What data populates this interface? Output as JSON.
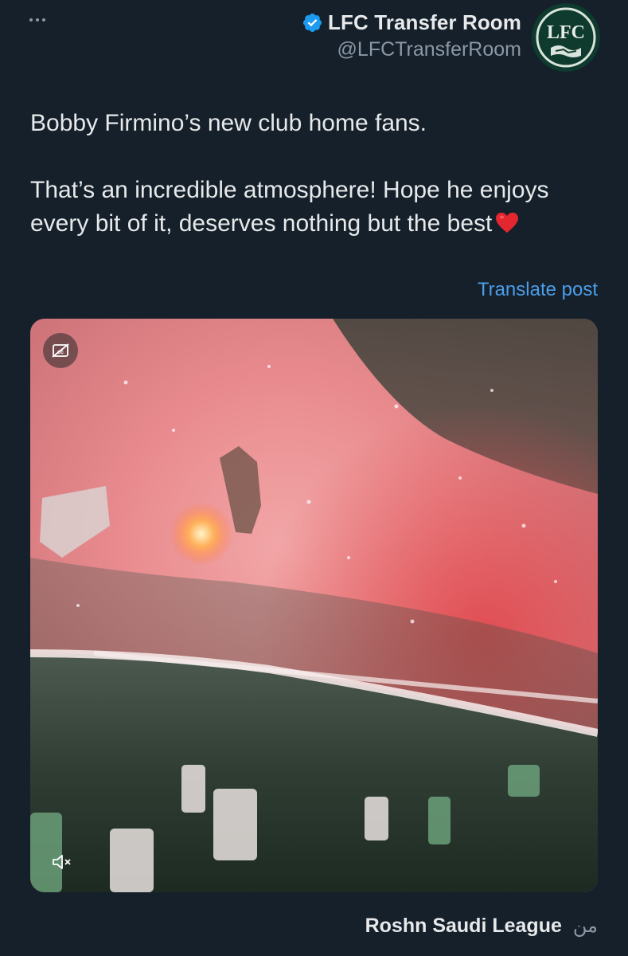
{
  "header": {
    "more_icon": "more-horizontal-icon",
    "display_name": "LFC Transfer Room",
    "handle": "@LFCTransferRoom",
    "verified_icon": "verified-badge-icon",
    "avatar_logo_text": "LFC"
  },
  "tweet": {
    "line1": "Bobby Firmino’s new club home fans.",
    "line2": "That’s an incredible atmosphere! Hope he enjoys every bit of it, deserves nothing but the best",
    "emoji_icon": "red-heart-icon"
  },
  "translate_label": "Translate post",
  "media": {
    "captions_icon": "closed-captions-off-icon",
    "mute_icon": "volume-muted-icon"
  },
  "place": {
    "prefix": "من",
    "name": "Roshn Saudi League"
  },
  "colors": {
    "background": "#15202b",
    "text": "#e7e9ea",
    "muted": "#8b98a5",
    "link": "#4c9ee8",
    "verified": "#1d9bf0",
    "avatar_green": "#0f3b2e"
  }
}
